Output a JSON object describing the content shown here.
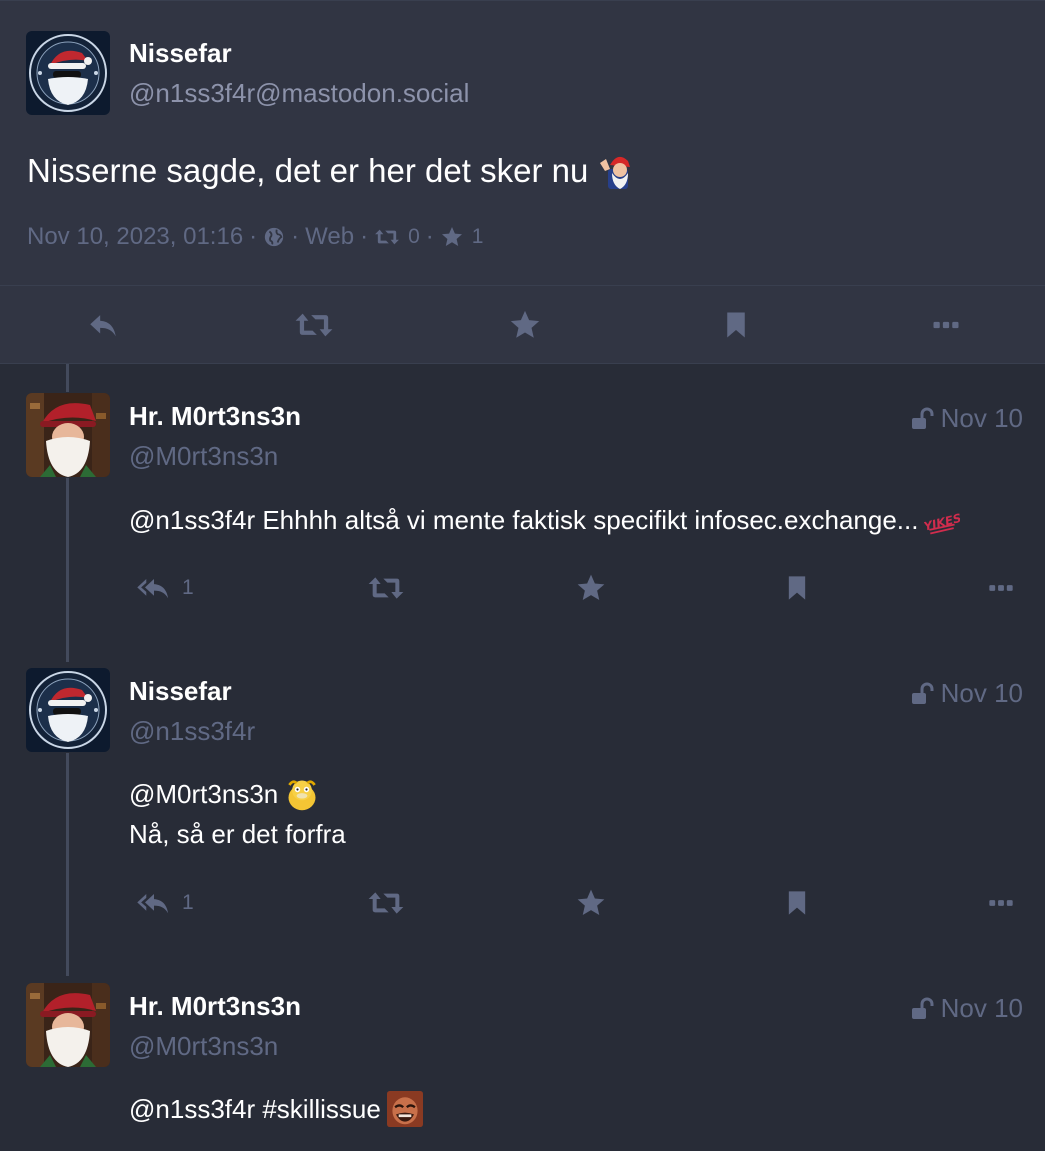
{
  "focused": {
    "display_name": "Nissefar",
    "acct": "@n1ss3f4r@mastodon.social",
    "content": "Nisserne sagde, det er her det sker nu",
    "content_emoji": "gnome-waving-emoji",
    "meta": {
      "timestamp": "Nov 10, 2023, 01:16",
      "visibility_icon": "globe-icon",
      "application": "Web",
      "boost_count": "0",
      "favourite_count": "1"
    },
    "actions": [
      "reply-icon",
      "boost-icon",
      "favourite-icon",
      "bookmark-icon",
      "more-icon"
    ]
  },
  "replies": [
    {
      "display_name": "Hr. M0rt3ns3n",
      "acct": "@M0rt3ns3n",
      "time": "Nov 10",
      "visibility_icon": "unlock-icon",
      "avatar": "santa-portrait",
      "content_lines": [
        "@n1ss3f4r Ehhhh altså vi mente faktisk specifikt infosec.exchange..."
      ],
      "content_emoji": "yikes-emoji",
      "reply_count": "1"
    },
    {
      "display_name": "Nissefar",
      "acct": "@n1ss3f4r",
      "time": "Nov 10",
      "visibility_icon": "unlock-icon",
      "avatar": "santa-logo",
      "content_lines": [
        "@M0rt3ns3n",
        "Nå, så er det forfra"
      ],
      "content_emoji": "psyduck-emoji",
      "reply_count": "1"
    },
    {
      "display_name": "Hr. M0rt3ns3n",
      "acct": "@M0rt3ns3n",
      "time": "Nov 10",
      "visibility_icon": "unlock-icon",
      "avatar": "santa-portrait",
      "content_lines": [
        "@n1ss3f4r #skillissue"
      ],
      "content_emoji": "laughing-man-emoji"
    }
  ],
  "colors": {
    "background": "#282c37",
    "focused_background": "#313543",
    "muted_text": "#606984",
    "secondary_text": "#8d93ab",
    "icon": "#606984"
  }
}
